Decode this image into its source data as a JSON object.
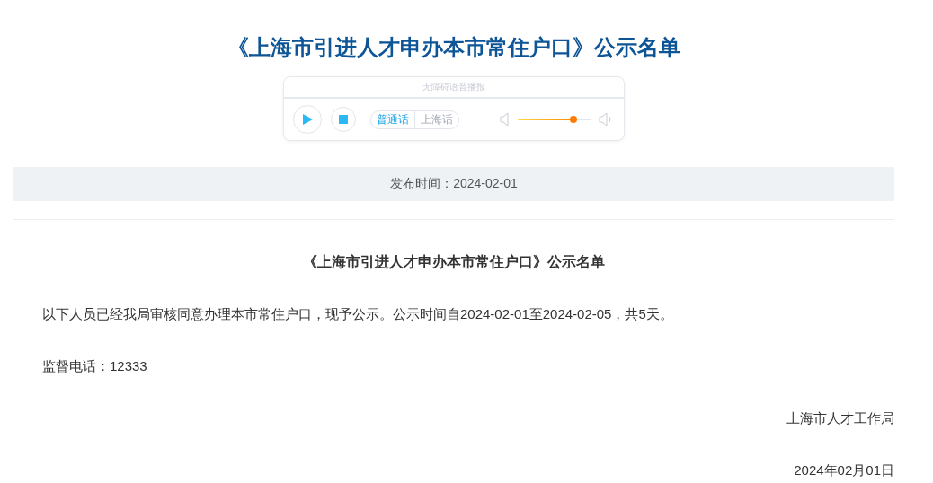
{
  "title": "《上海市引进人才申办本市常住户口》公示名单",
  "player": {
    "heading": "无障碍语音播报",
    "languages": [
      {
        "label": "普通话",
        "selected": true
      },
      {
        "label": "上海话",
        "selected": false
      }
    ],
    "volume": {
      "level": 0.76
    }
  },
  "publish_time": "发布时间：2024-02-01",
  "article": {
    "heading": "《上海市引进人才申办本市常住户口》公示名单",
    "paragraphs": [
      "以下人员已经我局审核同意办理本市常住户口，现予公示。公示时间自2024-02-01至2024-02-05，共5天。",
      "监督电话：12333"
    ],
    "signature": [
      "上海市人才工作局",
      "2024年02月01日"
    ]
  }
}
